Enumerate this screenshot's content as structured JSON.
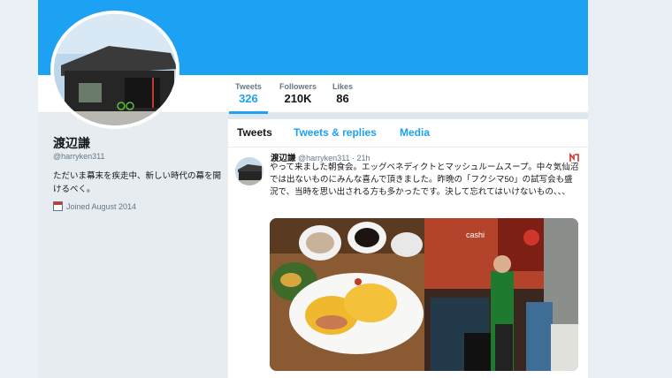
{
  "header": {
    "stats": [
      {
        "label": "Tweets",
        "value": "326"
      },
      {
        "label": "Followers",
        "value": "210K"
      },
      {
        "label": "Likes",
        "value": "86"
      }
    ],
    "banner_color": "#1da1f2"
  },
  "profile": {
    "name": "渡辺謙",
    "handle": "@harryken311",
    "bio": "ただいま幕末を疾走中、新しい時代の幕を開けるべく。",
    "joined": "Joined August 2014",
    "joined_icon": "calendar-icon"
  },
  "timeline": {
    "tabs": [
      "Tweets",
      "Tweets & replies",
      "Media"
    ],
    "tweet": {
      "author": "渡辺謙",
      "handle": "@harryken311",
      "time": "· 21h",
      "text": "やって来ました朝食会。エッグベネディクトとマッシュルームスープ。中々気仙沼では出ないものにみんな喜んで頂きました。昨晩の「フクシマ50」の試写会も盛況で、当時を思い出される方も多かったです。決して忘れてはいけないもの、、、",
      "brand_icon": "brand-logo-icon",
      "photo_text": "cashi"
    }
  },
  "colors": {
    "accent": "#1da1f2",
    "text": "#14171a",
    "secondary": "#657786"
  }
}
